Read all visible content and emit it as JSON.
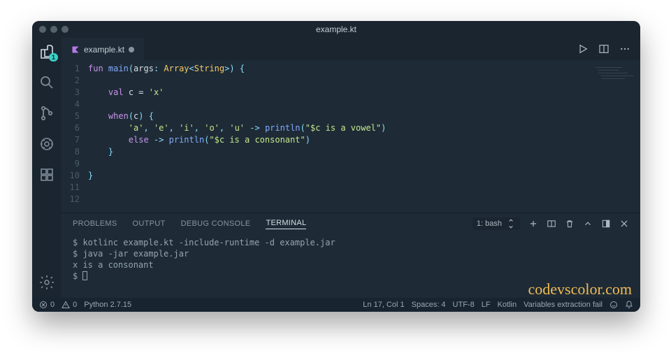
{
  "window": {
    "title": "example.kt"
  },
  "tab": {
    "filename": "example.kt",
    "modified": true
  },
  "activity": {
    "explorer_badge": "1"
  },
  "code": {
    "lines": [
      {
        "n": "1",
        "seg": [
          {
            "c": "kw",
            "t": "fun "
          },
          {
            "c": "fn",
            "t": "main"
          },
          {
            "c": "pu",
            "t": "("
          },
          {
            "c": "id",
            "t": "args"
          },
          {
            "c": "pu",
            "t": ": "
          },
          {
            "c": "ty",
            "t": "Array"
          },
          {
            "c": "pu",
            "t": "<"
          },
          {
            "c": "ty",
            "t": "String"
          },
          {
            "c": "pu",
            "t": ">) {"
          }
        ]
      },
      {
        "n": "2",
        "seg": []
      },
      {
        "n": "3",
        "seg": [
          {
            "c": "pl",
            "t": "    "
          },
          {
            "c": "kw",
            "t": "val "
          },
          {
            "c": "id",
            "t": "c"
          },
          {
            "c": "pl",
            "t": " = "
          },
          {
            "c": "str",
            "t": "'x'"
          }
        ]
      },
      {
        "n": "4",
        "seg": []
      },
      {
        "n": "5",
        "seg": [
          {
            "c": "pl",
            "t": "    "
          },
          {
            "c": "kw",
            "t": "when"
          },
          {
            "c": "pu",
            "t": "("
          },
          {
            "c": "id",
            "t": "c"
          },
          {
            "c": "pu",
            "t": ") {"
          }
        ]
      },
      {
        "n": "6",
        "seg": [
          {
            "c": "pl",
            "t": "        "
          },
          {
            "c": "str",
            "t": "'a'"
          },
          {
            "c": "pu",
            "t": ", "
          },
          {
            "c": "str",
            "t": "'e'"
          },
          {
            "c": "pu",
            "t": ", "
          },
          {
            "c": "str",
            "t": "'i'"
          },
          {
            "c": "pu",
            "t": ", "
          },
          {
            "c": "str",
            "t": "'o'"
          },
          {
            "c": "pu",
            "t": ", "
          },
          {
            "c": "str",
            "t": "'u'"
          },
          {
            "c": "pu",
            "t": " -> "
          },
          {
            "c": "fn",
            "t": "println"
          },
          {
            "c": "pu",
            "t": "("
          },
          {
            "c": "str",
            "t": "\"$c is a vowel\""
          },
          {
            "c": "pu",
            "t": ")"
          }
        ]
      },
      {
        "n": "7",
        "seg": [
          {
            "c": "pl",
            "t": "        "
          },
          {
            "c": "kw",
            "t": "else"
          },
          {
            "c": "pu",
            "t": " -> "
          },
          {
            "c": "fn",
            "t": "println"
          },
          {
            "c": "pu",
            "t": "("
          },
          {
            "c": "str",
            "t": "\"$c is a consonant\""
          },
          {
            "c": "pu",
            "t": ")"
          }
        ]
      },
      {
        "n": "8",
        "seg": [
          {
            "c": "pl",
            "t": "    "
          },
          {
            "c": "pu",
            "t": "}"
          }
        ]
      },
      {
        "n": "9",
        "seg": []
      },
      {
        "n": "10",
        "seg": [
          {
            "c": "pu",
            "t": "}"
          }
        ]
      },
      {
        "n": "11",
        "seg": []
      },
      {
        "n": "12",
        "seg": []
      }
    ]
  },
  "panel": {
    "tabs": {
      "problems": "PROBLEMS",
      "output": "OUTPUT",
      "debug": "DEBUG CONSOLE",
      "terminal": "TERMINAL"
    },
    "terminal_select": "1: bash",
    "lines": [
      "$ kotlinc example.kt -include-runtime -d example.jar",
      "$ java -jar example.jar",
      "x is a consonant",
      "$ "
    ]
  },
  "status": {
    "errors": "0",
    "warnings": "0",
    "python": "Python 2.7.15",
    "position": "Ln 17, Col 1",
    "spaces": "Spaces: 4",
    "encoding": "UTF-8",
    "eol": "LF",
    "lang": "Kotlin",
    "extra": "Variables extraction fail"
  },
  "watermark": "codevscolor.com"
}
